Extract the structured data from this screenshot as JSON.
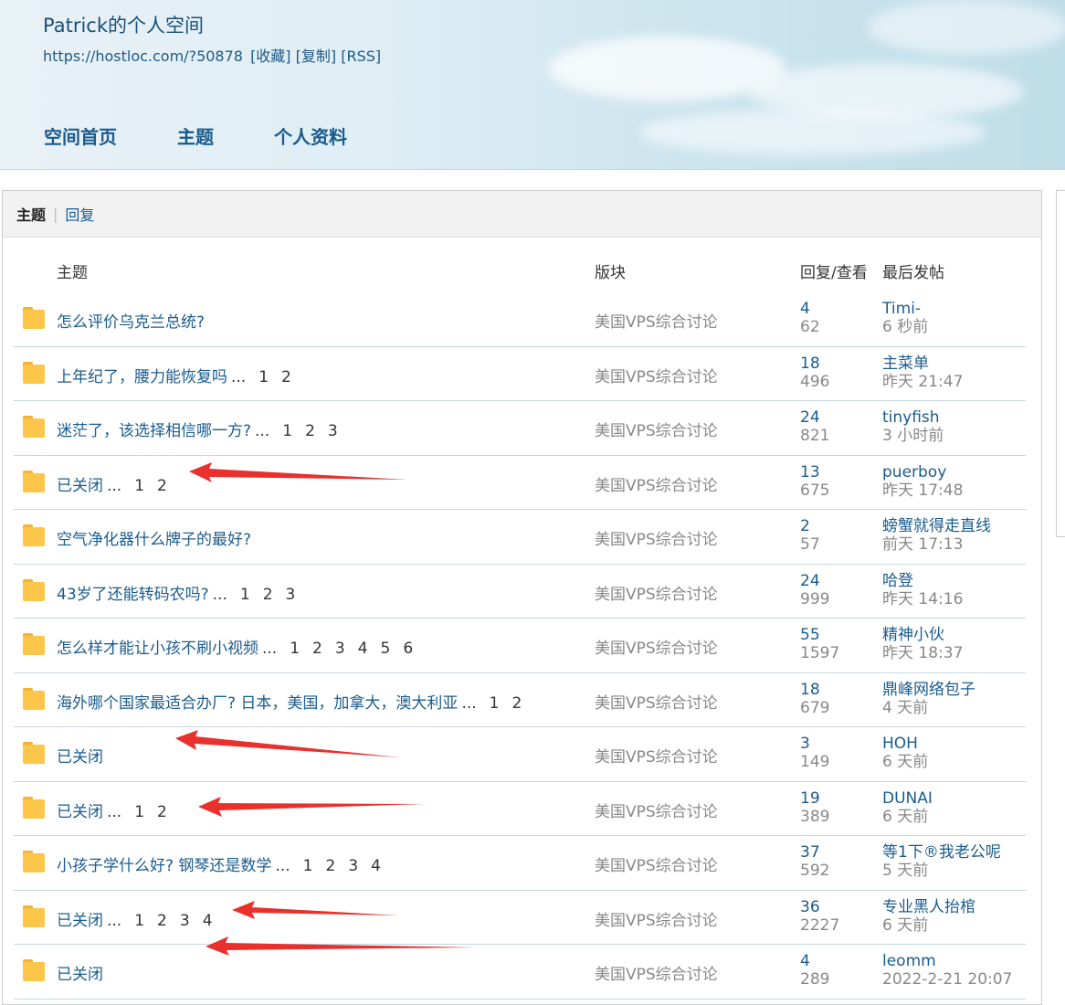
{
  "header": {
    "title": "Patrick的个人空间",
    "url": "https://hostloc.com/?50878",
    "link_favorite": "[收藏]",
    "link_copy": "[复制]",
    "link_rss": "[RSS]"
  },
  "nav": {
    "home": "空间首页",
    "threads": "主题",
    "profile": "个人资料"
  },
  "tabs": {
    "active": "主题",
    "separator": "|",
    "replies": "回复"
  },
  "table": {
    "headers": {
      "topic": "主题",
      "forum": "版块",
      "replies_views": "回复/查看",
      "last_post": "最后发帖"
    },
    "rows": [
      {
        "title": "怎么评价乌克兰总统?",
        "dots": "",
        "pages": [],
        "forum": "美国VPS综合讨论",
        "replies": "4",
        "views": "62",
        "user": "Timi-",
        "time": "6 秒前"
      },
      {
        "title": "上年纪了，腰力能恢复吗",
        "dots": "...",
        "pages": [
          "1",
          "2"
        ],
        "forum": "美国VPS综合讨论",
        "replies": "18",
        "views": "496",
        "user": "主菜单",
        "time": "昨天 21:47"
      },
      {
        "title": "迷茫了，该选择相信哪一方?",
        "dots": "...",
        "pages": [
          "1",
          "2",
          "3"
        ],
        "forum": "美国VPS综合讨论",
        "replies": "24",
        "views": "821",
        "user": "tinyfish",
        "time": "3 小时前"
      },
      {
        "title": "已关闭",
        "dots": "...",
        "pages": [
          "1",
          "2"
        ],
        "forum": "美国VPS综合讨论",
        "replies": "13",
        "views": "675",
        "user": "puerboy",
        "time": "昨天 17:48"
      },
      {
        "title": "空气净化器什么牌子的最好?",
        "dots": "",
        "pages": [],
        "forum": "美国VPS综合讨论",
        "replies": "2",
        "views": "57",
        "user": "螃蟹就得走直线",
        "time": "前天 17:13"
      },
      {
        "title": "43岁了还能转码农吗?",
        "dots": "...",
        "pages": [
          "1",
          "2",
          "3"
        ],
        "forum": "美国VPS综合讨论",
        "replies": "24",
        "views": "999",
        "user": "哈登",
        "time": "昨天 14:16"
      },
      {
        "title": "怎么样才能让小孩不刷小视频",
        "dots": "...",
        "pages": [
          "1",
          "2",
          "3",
          "4",
          "5",
          "6"
        ],
        "forum": "美国VPS综合讨论",
        "replies": "55",
        "views": "1597",
        "user": "精神小伙",
        "time": "昨天 18:37"
      },
      {
        "title": "海外哪个国家最适合办厂? 日本，美国，加拿大，澳大利亚",
        "dots": "...",
        "pages": [
          "1",
          "2"
        ],
        "forum": "美国VPS综合讨论",
        "replies": "18",
        "views": "679",
        "user": "鼎峰网络包子",
        "time": "4 天前"
      },
      {
        "title": "已关闭",
        "dots": "",
        "pages": [],
        "forum": "美国VPS综合讨论",
        "replies": "3",
        "views": "149",
        "user": "HOH",
        "time": "6 天前"
      },
      {
        "title": "已关闭",
        "dots": "...",
        "pages": [
          "1",
          "2"
        ],
        "forum": "美国VPS综合讨论",
        "replies": "19",
        "views": "389",
        "user": "DUNAI",
        "time": "6 天前"
      },
      {
        "title": "小孩子学什么好? 钢琴还是数学",
        "dots": "...",
        "pages": [
          "1",
          "2",
          "3",
          "4"
        ],
        "forum": "美国VPS综合讨论",
        "replies": "37",
        "views": "592",
        "user": "等1下®我老公呢",
        "time": "5 天前"
      },
      {
        "title": "已关闭",
        "dots": "...",
        "pages": [
          "1",
          "2",
          "3",
          "4"
        ],
        "forum": "美国VPS综合讨论",
        "replies": "36",
        "views": "2227",
        "user": "专业黑人抬棺",
        "time": "6 天前"
      },
      {
        "title": "已关闭",
        "dots": "",
        "pages": [],
        "forum": "美国VPS综合讨论",
        "replies": "4",
        "views": "289",
        "user": "leomm",
        "time": "2022-2-21 20:07"
      }
    ]
  },
  "colors": {
    "link": "#1a5b8e",
    "muted": "#888888",
    "folder": "#fbc64a",
    "arrow": "#e8302c"
  },
  "icons": {
    "row_icon": "folder-icon",
    "annotation": "red-arrow"
  }
}
